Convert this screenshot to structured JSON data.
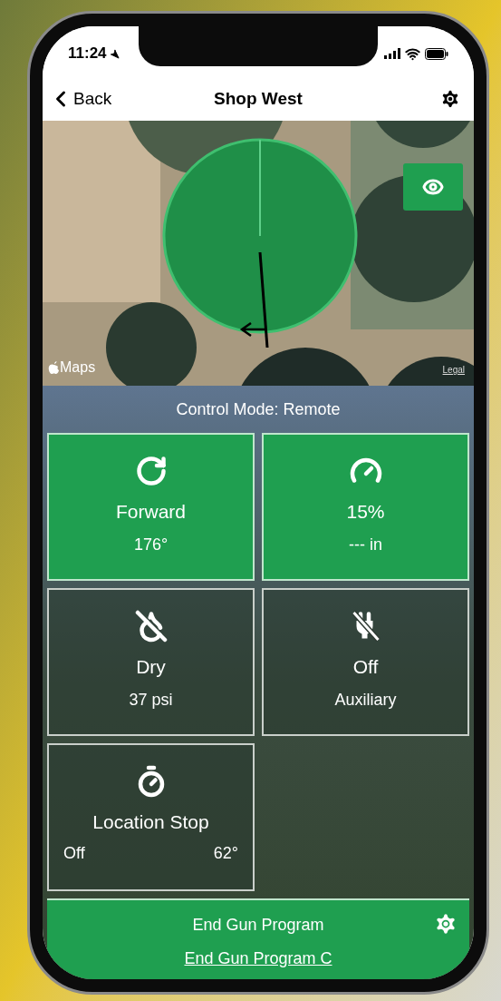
{
  "status_bar": {
    "time": "11:24"
  },
  "nav": {
    "back": "Back",
    "title": "Shop West"
  },
  "map": {
    "attribution": "Maps",
    "legal": "Legal"
  },
  "control_mode": "Control Mode: Remote",
  "tiles": [
    {
      "kind": "direction",
      "active": true,
      "label": "Forward",
      "value": "176°"
    },
    {
      "kind": "speed",
      "active": true,
      "label": "15%",
      "value": "--- in"
    },
    {
      "kind": "water",
      "active": false,
      "label": "Dry",
      "value": "37 psi"
    },
    {
      "kind": "auxiliary",
      "active": false,
      "label": "Off",
      "value": "Auxiliary"
    },
    {
      "kind": "location_stop",
      "active": false,
      "label": "Location Stop",
      "value": "Off",
      "reading": "62°"
    }
  ],
  "end_gun": {
    "title": "End Gun Program",
    "program": "End Gun Program C"
  }
}
